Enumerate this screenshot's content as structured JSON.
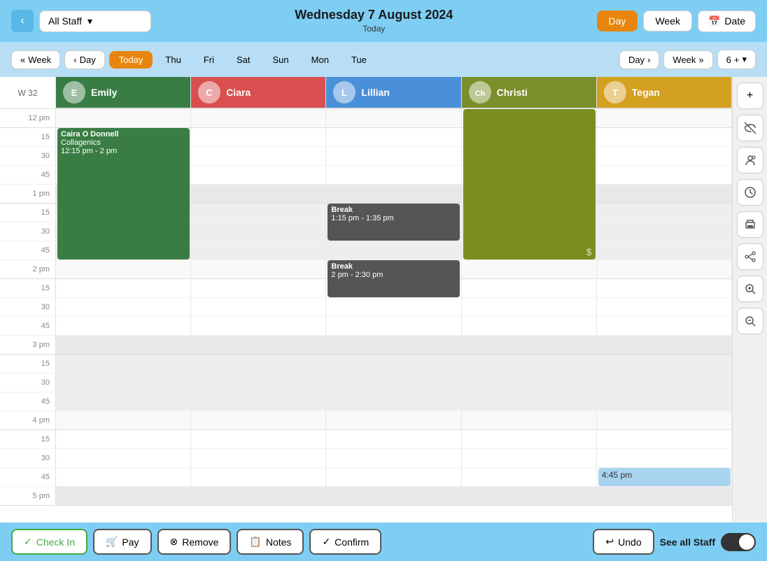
{
  "topBar": {
    "backLabel": "‹",
    "staffDropdown": "All Staff",
    "title": "Wednesday 7 August 2024",
    "subtitle": "Today",
    "dayBtn": "Day",
    "weekBtn": "Week",
    "dateBtn": "Date"
  },
  "subNav": {
    "weekLabel": "Week",
    "dayLabel": "Day",
    "tabs": [
      "Today",
      "Thu",
      "Fri",
      "Sat",
      "Sun",
      "Mon",
      "Tue"
    ],
    "activeTab": "Today",
    "rightDay": "Day",
    "rightWeek": "Week",
    "count": "6"
  },
  "staffColumns": [
    {
      "id": "emily",
      "name": "Emily",
      "avatarColor": "#3a7d44",
      "initials": "E"
    },
    {
      "id": "ciara",
      "name": "Ciara",
      "avatarColor": "#d94f4f",
      "initials": "C"
    },
    {
      "id": "lillian",
      "name": "Lillian",
      "avatarColor": "#4a90d9",
      "initials": "L"
    },
    {
      "id": "christi",
      "name": "Christi",
      "avatarColor": "#5d7a2e",
      "initials": "Ch"
    },
    {
      "id": "tegan",
      "name": "Tegan",
      "avatarColor": "#d4a020",
      "initials": "T"
    }
  ],
  "weekLabel": "W 32",
  "events": {
    "emily_appointment": {
      "title": "Caira O Donnell",
      "subtitle": "Collagenics",
      "time": "12:15 pm - 2 pm",
      "color": "#3a7d44"
    },
    "lillian_break1": {
      "title": "Break",
      "time": "1:15 pm - 1:35 pm",
      "color": "#555"
    },
    "lillian_break2": {
      "title": "Break",
      "time": "2 pm - 2:30 pm",
      "color": "#555"
    },
    "tegan_slot": {
      "time": "4:45 pm",
      "color": "#a8d4f0"
    }
  },
  "sideToolbar": {
    "buttons": [
      "plus",
      "eye-off",
      "users",
      "clock",
      "print",
      "share",
      "zoom-in",
      "zoom-out"
    ]
  },
  "bottomBar": {
    "checkIn": "Check In",
    "pay": "Pay",
    "remove": "Remove",
    "notes": "Notes",
    "confirm": "Confirm",
    "undo": "Undo",
    "seeAll": "See all Staff"
  },
  "timeSlots": [
    {
      "label": "12 pm",
      "isHour": true,
      "min": 0
    },
    {
      "label": "15",
      "isHour": false,
      "min": 15
    },
    {
      "label": "30",
      "isHour": false,
      "min": 30
    },
    {
      "label": "45",
      "isHour": false,
      "min": 45
    },
    {
      "label": "1 pm",
      "isHour": true,
      "min": 60
    },
    {
      "label": "15",
      "isHour": false,
      "min": 75
    },
    {
      "label": "30",
      "isHour": false,
      "min": 90
    },
    {
      "label": "45",
      "isHour": false,
      "min": 105
    },
    {
      "label": "2 pm",
      "isHour": true,
      "min": 120
    },
    {
      "label": "15",
      "isHour": false,
      "min": 135
    },
    {
      "label": "30",
      "isHour": false,
      "min": 150
    },
    {
      "label": "45",
      "isHour": false,
      "min": 165
    },
    {
      "label": "3 pm",
      "isHour": true,
      "min": 180
    },
    {
      "label": "15",
      "isHour": false,
      "min": 195
    },
    {
      "label": "30",
      "isHour": false,
      "min": 210
    },
    {
      "label": "45",
      "isHour": false,
      "min": 225
    },
    {
      "label": "4 pm",
      "isHour": true,
      "min": 240
    },
    {
      "label": "15",
      "isHour": false,
      "min": 255
    },
    {
      "label": "30",
      "isHour": false,
      "min": 270
    },
    {
      "label": "45",
      "isHour": false,
      "min": 285
    },
    {
      "label": "5 pm",
      "isHour": true,
      "min": 300
    }
  ]
}
